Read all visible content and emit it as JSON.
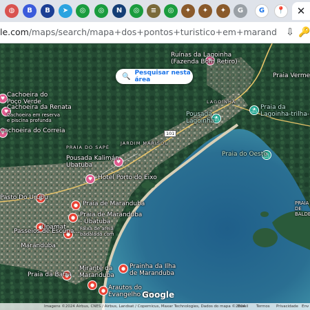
{
  "browser": {
    "tabs": [
      {
        "icon": "globe-icon",
        "glyph": "◍",
        "color": "#d9534f"
      },
      {
        "icon": "b-icon",
        "glyph": "B",
        "color": "#3b5bdb"
      },
      {
        "icon": "b-icon",
        "glyph": "B",
        "color": "#1c3f94"
      },
      {
        "icon": "telegram-icon",
        "glyph": "➤",
        "color": "#2aa3e0"
      },
      {
        "icon": "chrome-store-icon",
        "glyph": "◎",
        "color": "#1a9c3e"
      },
      {
        "icon": "chrome-store-icon",
        "glyph": "◎",
        "color": "#1a9c3e"
      },
      {
        "icon": "cnn-icon",
        "glyph": "N",
        "color": "#153e75"
      },
      {
        "icon": "chrome-store-icon",
        "glyph": "◎",
        "color": "#1a9c3e"
      },
      {
        "icon": "news-icon",
        "glyph": "≡",
        "color": "#7a6a3a"
      },
      {
        "icon": "chrome-store-icon",
        "glyph": "◎",
        "color": "#1a9c3e"
      },
      {
        "icon": "seal-icon",
        "glyph": "✦",
        "color": "#8a5a2b"
      },
      {
        "icon": "seal-icon",
        "glyph": "✦",
        "color": "#8a5a2b"
      },
      {
        "icon": "seal-icon",
        "glyph": "✦",
        "color": "#8a5a2b"
      },
      {
        "icon": "google-icon",
        "glyph": "G",
        "color": "#9aa0a6"
      },
      {
        "icon": "google-icon",
        "glyph": "G",
        "color": "#ffffff"
      },
      {
        "icon": "maps-icon",
        "glyph": "📍",
        "color": "#ffffff"
      }
    ],
    "active_tab_glyph": "✕",
    "url_domain": "le.com",
    "url_path": "/maps/search/mapa+dos+pontos+turistico+em+maranduba+ubatuba+sp/...",
    "download_glyph": "⇩",
    "ext_glyph": "🔑"
  },
  "map": {
    "search_area_label": "Pesquisar nesta área",
    "places": [
      {
        "name": "Ruínas da Lagoinha\n(Fazenda Bom Retiro)",
        "pin": "pink"
      },
      {
        "name": "Cachoeira do\nPoço Verde",
        "pin": "pink"
      },
      {
        "name": "Cachoeira da Renata",
        "pin": "pink"
      },
      {
        "name": "Cachoeira em reserva\ne piscina profunda",
        "pin": "none"
      },
      {
        "name": "Cachoeira do Correia",
        "pin": "pink"
      },
      {
        "name": "Pousada Kalimán\nUbatuba",
        "pin": "pink"
      },
      {
        "name": "Hotel Porto do Eixo",
        "pin": "pink"
      },
      {
        "name": "Praia de Maranduba",
        "pin": "red"
      },
      {
        "name": "Praia de Maranduba\n- Ubatuba",
        "pin": "red"
      },
      {
        "name": "Faixa de areia\nbadalada com",
        "pin": "none"
      },
      {
        "name": "Upamat",
        "pin": "red"
      },
      {
        "name": "Passeios de Escuna...",
        "pin": "red"
      },
      {
        "name": "Maranduba",
        "pin": "none"
      },
      {
        "name": "Pasto Do Urubu",
        "pin": "red"
      },
      {
        "name": "Praia da Barra",
        "pin": "red"
      },
      {
        "name": "Mirante da\nMaranduba",
        "pin": "red"
      },
      {
        "name": "Prainha da Ilha\nde Maranduba",
        "pin": "red"
      },
      {
        "name": "Arautos do\nEvangelho em...",
        "pin": "red"
      },
      {
        "name": "Pousada\nLagoinha",
        "pin": "teal"
      },
      {
        "name": "Praia da\nLagoinha-trilha-ponto",
        "pin": "teal"
      },
      {
        "name": "Praia do Oeste",
        "pin": "teal"
      },
      {
        "name": "Praia Vermelha",
        "pin": "none"
      },
      {
        "name": "PRAIA\nDE\nBALDE",
        "pin": "none"
      }
    ],
    "roads": [
      "PRAIA DO SAPÉ",
      "JARDIM MARISOL",
      "LAGOINHA"
    ],
    "highway": "101",
    "attribution": "Imagens ©2024 Airbus, CNES / Airbus, Landsat / Copernicus, Maxar Technologies, Dados do mapa ©2024",
    "footer_links": [
      "Brasil",
      "Termos",
      "Privacidade",
      "Env"
    ],
    "logo": "Google"
  }
}
